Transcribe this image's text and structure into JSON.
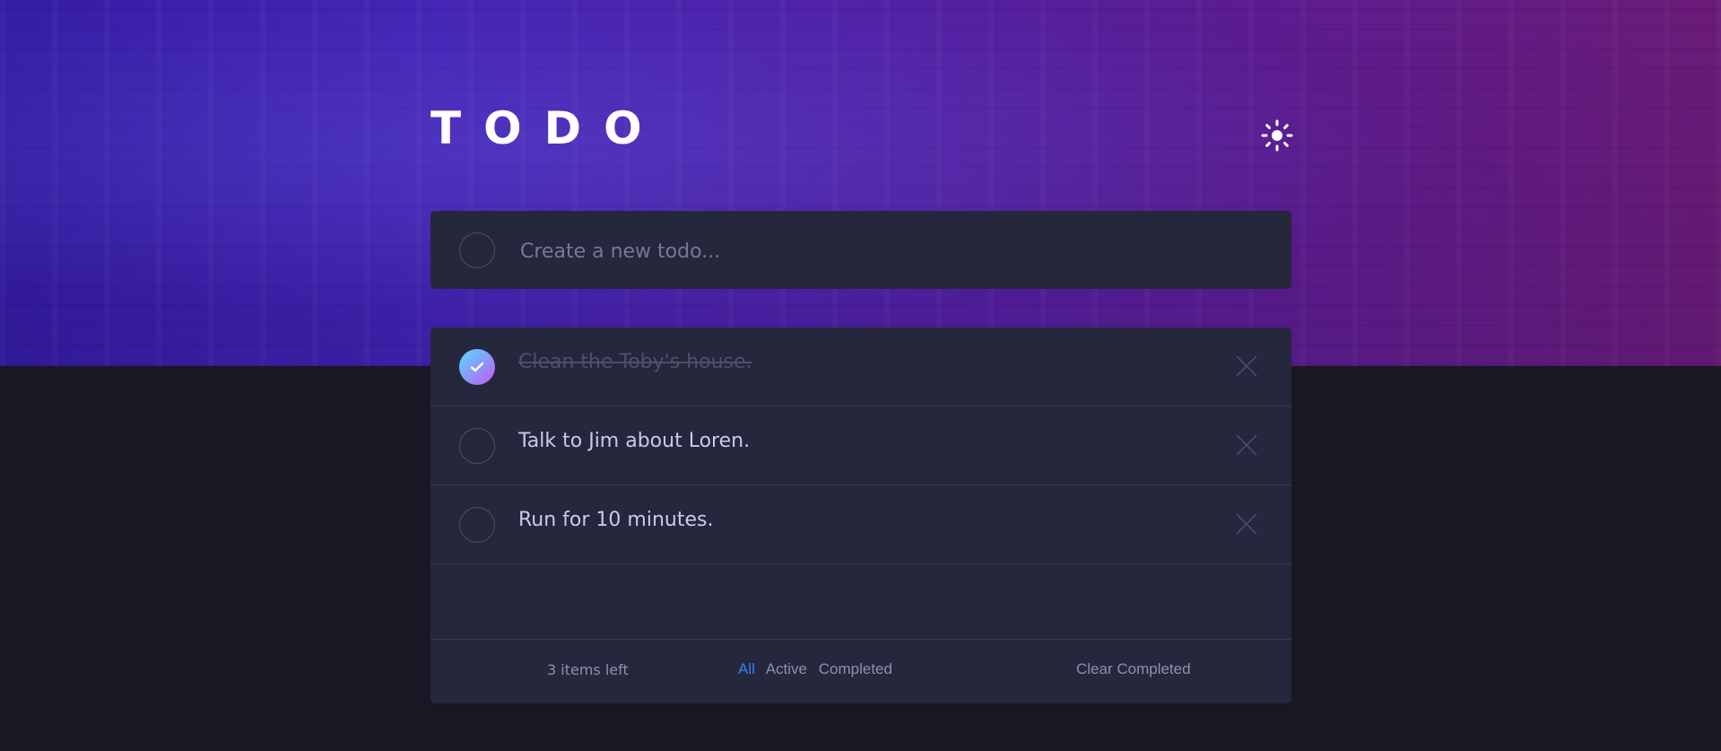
{
  "header": {
    "title": "TODO",
    "theme_icon": "sun-icon"
  },
  "create": {
    "placeholder": "Create a new todo..."
  },
  "todos": [
    {
      "text": "Clean the Toby's house.",
      "completed": true
    },
    {
      "text": "Talk to Jim about Loren.",
      "completed": false
    },
    {
      "text": "Run for 10 minutes.",
      "completed": false
    }
  ],
  "footer": {
    "items_left": "3 items left",
    "filters": {
      "all": "All",
      "active": "Active",
      "completed": "Completed"
    },
    "active_filter": "All",
    "clear_completed": "Clear Completed"
  },
  "colors": {
    "accent": "#3a7cfd",
    "check_gradient_start": "#55ddff",
    "check_gradient_end": "#c058f3",
    "card_background": "#25273d",
    "page_background": "#171823"
  }
}
